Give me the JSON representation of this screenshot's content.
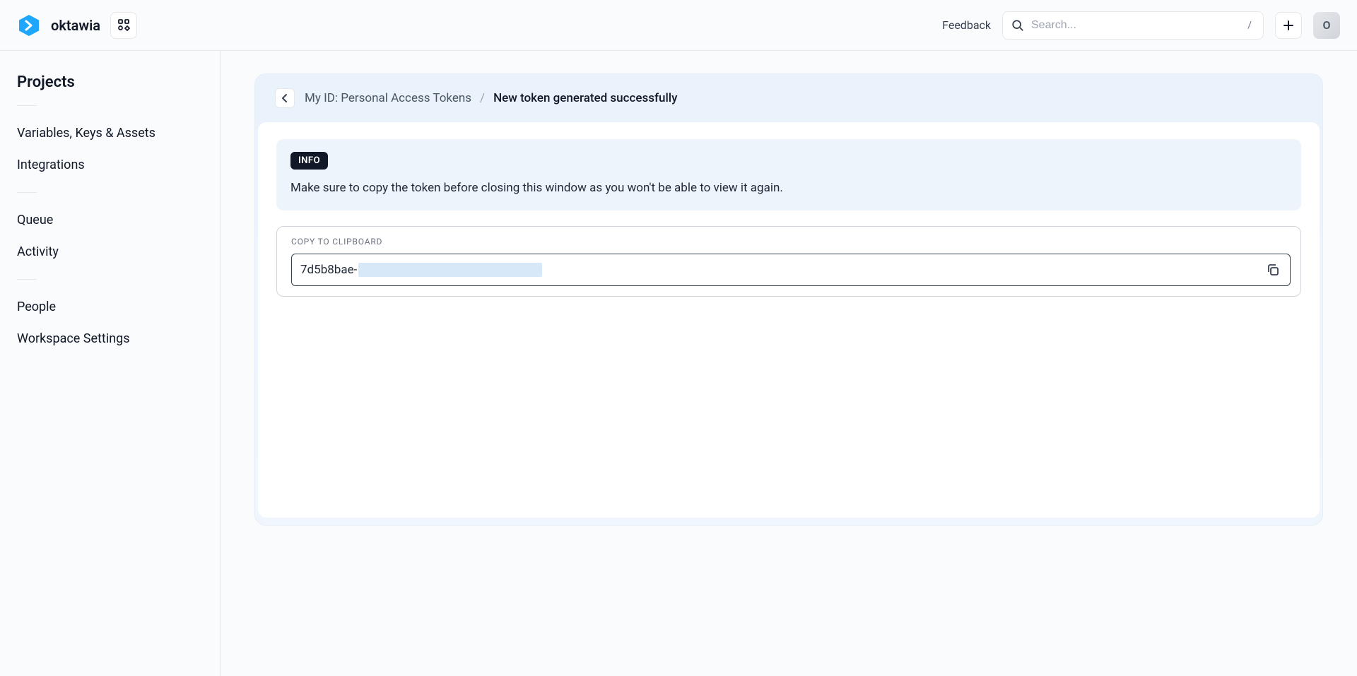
{
  "header": {
    "brand": "oktawia",
    "feedback": "Feedback",
    "search_placeholder": "Search...",
    "search_kbd": "/",
    "avatar_initial": "O"
  },
  "sidebar": {
    "title": "Projects",
    "groups": [
      [
        "Variables, Keys & Assets",
        "Integrations"
      ],
      [
        "Queue",
        "Activity"
      ],
      [
        "People",
        "Workspace Settings"
      ]
    ]
  },
  "breadcrumbs": {
    "parent": "My ID: Personal Access Tokens",
    "sep": "/",
    "current": "New token generated successfully"
  },
  "info": {
    "badge": "INFO",
    "message": "Make sure to copy the token before closing this window as you won't be able to view it again."
  },
  "copy": {
    "label": "COPY TO CLIPBOARD",
    "token_visible_prefix": "7d5b8bae-"
  }
}
